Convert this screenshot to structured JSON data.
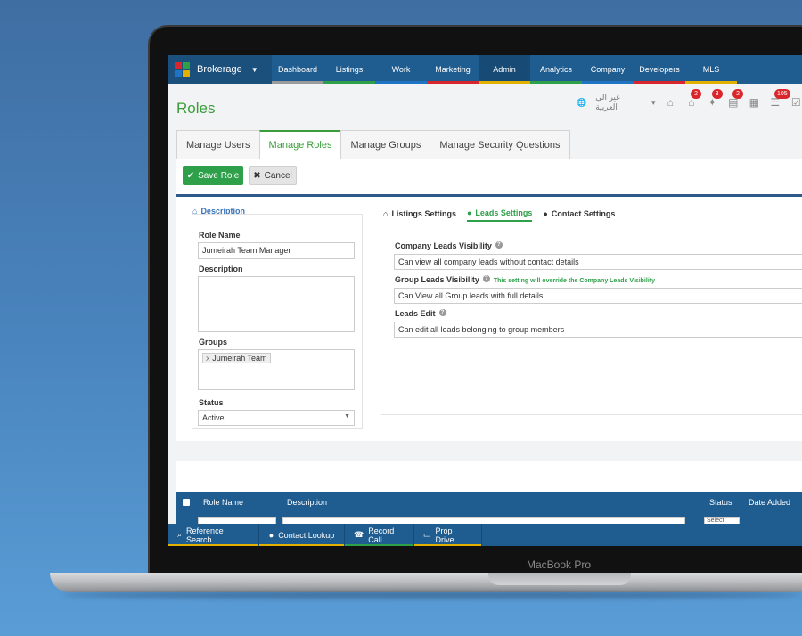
{
  "device": {
    "label": "MacBook Pro"
  },
  "topnav": {
    "brand": "Brokerage",
    "items": [
      {
        "label": "Dashboard",
        "color": "#9b9b9b"
      },
      {
        "label": "Listings",
        "color": "#2fa04a"
      },
      {
        "label": "Work",
        "color": "#1f74c4"
      },
      {
        "label": "Marketing",
        "color": "#d9262c"
      },
      {
        "label": "Admin",
        "color": "#e2b100"
      },
      {
        "label": "Analytics",
        "color": "#2fa04a"
      },
      {
        "label": "Company",
        "color": "#1f74c4"
      },
      {
        "label": "Developers",
        "color": "#d9262c"
      },
      {
        "label": "MLS",
        "color": "#e2b100"
      }
    ]
  },
  "header": {
    "title": "Roles",
    "language": "غير الى العربية",
    "badges": [
      "2",
      "3",
      "2",
      "105"
    ]
  },
  "tabs": [
    "Manage Users",
    "Manage Roles",
    "Manage Groups",
    "Manage Security Questions"
  ],
  "actions": {
    "save": "Save Role",
    "cancel": "Cancel"
  },
  "description": {
    "title": "Description",
    "role_name_label": "Role Name",
    "role_name_value": "Jumeirah Team Manager",
    "description_label": "Description",
    "description_value": "",
    "groups_label": "Groups",
    "group_tag": "Jumeirah Team",
    "status_label": "Status",
    "status_value": "Active"
  },
  "settings": {
    "tabs": [
      "Listings Settings",
      "Leads Settings",
      "Contact Settings"
    ],
    "company_label": "Company Leads Visibility",
    "company_value": "Can view all company leads without contact details",
    "group_label": "Group Leads Visibility",
    "group_note": "This setting will override the Company Leads Visibility",
    "group_value": "Can View all Group leads with full details",
    "edit_label": "Leads Edit",
    "edit_value": "Can edit all leads belonging to group members"
  },
  "table": {
    "columns": [
      "Role Name",
      "Description",
      "Status",
      "Date Added"
    ],
    "status_filter": "Select"
  },
  "bottombar": [
    {
      "label": "Reference Search",
      "color": "#e2b100"
    },
    {
      "label": "Contact Lookup",
      "color": "#e2b100"
    },
    {
      "label": "Record Call",
      "color": "#2fa04a"
    },
    {
      "label": "Prop Drive",
      "color": "#e2b100"
    }
  ]
}
